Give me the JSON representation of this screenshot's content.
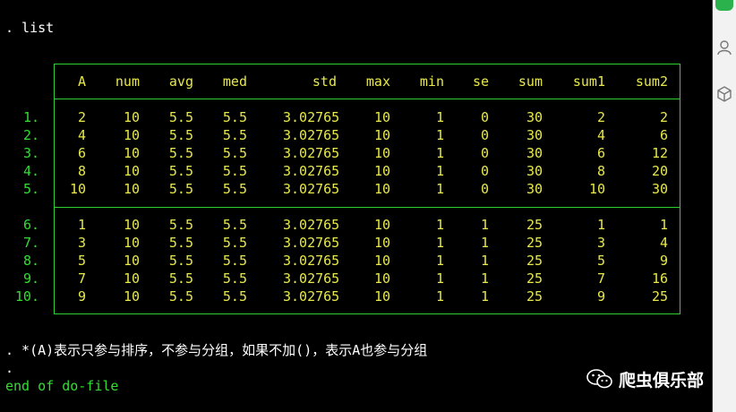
{
  "console": {
    "command_list": ". list",
    "comment": ". *(A)表示只参与排序，不参与分组，如果不加()，表示A也参与分组",
    "dot": ".",
    "end_text": "end of do-file"
  },
  "table": {
    "headers": [
      "A",
      "num",
      "avg",
      "med",
      "std",
      "max",
      "min",
      "se",
      "sum",
      "sum1",
      "sum2"
    ],
    "group1": [
      {
        "n": "1.",
        "cells": [
          "2",
          "10",
          "5.5",
          "5.5",
          "3.02765",
          "10",
          "1",
          "0",
          "30",
          "2",
          "2"
        ]
      },
      {
        "n": "2.",
        "cells": [
          "4",
          "10",
          "5.5",
          "5.5",
          "3.02765",
          "10",
          "1",
          "0",
          "30",
          "4",
          "6"
        ]
      },
      {
        "n": "3.",
        "cells": [
          "6",
          "10",
          "5.5",
          "5.5",
          "3.02765",
          "10",
          "1",
          "0",
          "30",
          "6",
          "12"
        ]
      },
      {
        "n": "4.",
        "cells": [
          "8",
          "10",
          "5.5",
          "5.5",
          "3.02765",
          "10",
          "1",
          "0",
          "30",
          "8",
          "20"
        ]
      },
      {
        "n": "5.",
        "cells": [
          "10",
          "10",
          "5.5",
          "5.5",
          "3.02765",
          "10",
          "1",
          "0",
          "30",
          "10",
          "30"
        ]
      }
    ],
    "group2": [
      {
        "n": "6.",
        "cells": [
          "1",
          "10",
          "5.5",
          "5.5",
          "3.02765",
          "10",
          "1",
          "1",
          "25",
          "1",
          "1"
        ]
      },
      {
        "n": "7.",
        "cells": [
          "3",
          "10",
          "5.5",
          "5.5",
          "3.02765",
          "10",
          "1",
          "1",
          "25",
          "3",
          "4"
        ]
      },
      {
        "n": "8.",
        "cells": [
          "5",
          "10",
          "5.5",
          "5.5",
          "3.02765",
          "10",
          "1",
          "1",
          "25",
          "5",
          "9"
        ]
      },
      {
        "n": "9.",
        "cells": [
          "7",
          "10",
          "5.5",
          "5.5",
          "3.02765",
          "10",
          "1",
          "1",
          "25",
          "7",
          "16"
        ]
      },
      {
        "n": "10.",
        "cells": [
          "9",
          "10",
          "5.5",
          "5.5",
          "3.02765",
          "10",
          "1",
          "1",
          "25",
          "9",
          "25"
        ]
      }
    ]
  },
  "watermark": {
    "text": "爬虫俱乐部",
    "icon": "wechat-icon"
  },
  "sidebar": {
    "icons": [
      "user-icon",
      "cube-icon"
    ]
  },
  "colors": {
    "green": "#33dd33",
    "yellow": "#e8e84a",
    "background": "#000000"
  }
}
